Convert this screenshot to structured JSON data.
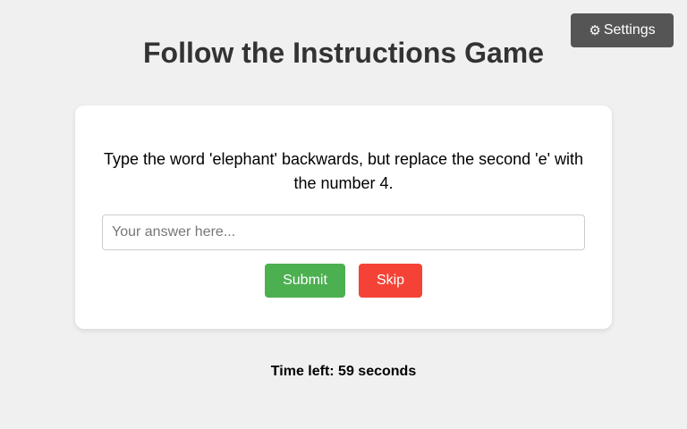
{
  "header": {
    "settings_icon": "gear-icon",
    "settings_icon_glyph": "⚙",
    "settings_label": "Settings",
    "title": "Follow the Instructions Game"
  },
  "game": {
    "instruction": "Type the word 'elephant' backwards, but replace the second 'e' with the number 4.",
    "answer_value": "",
    "answer_placeholder": "Your answer here...",
    "submit_label": "Submit",
    "skip_label": "Skip",
    "timer_text": "Time left: 59 seconds"
  },
  "colors": {
    "background": "#f0f0f0",
    "settings_button": "#555555",
    "submit_button": "#4caf50",
    "skip_button": "#f44336",
    "card": "#ffffff"
  }
}
